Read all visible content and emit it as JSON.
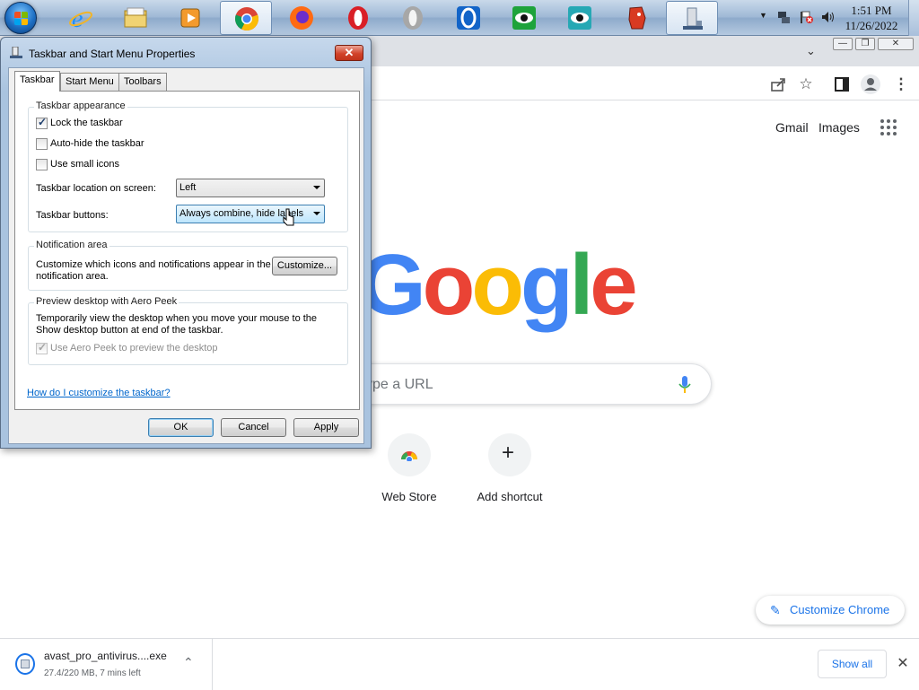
{
  "taskbar": {
    "apps": [
      {
        "name": "internet-explorer",
        "icon": "ie-icon",
        "color": "#1e90ff"
      },
      {
        "name": "windows-explorer",
        "icon": "folder-icon",
        "color": "#e9c65a"
      },
      {
        "name": "media-player",
        "icon": "media-player-icon",
        "color": "#f39a2d"
      },
      {
        "name": "chrome",
        "icon": "chrome-icon",
        "color": "#4285f4",
        "active": true
      },
      {
        "name": "firefox",
        "icon": "firefox-icon",
        "color": "#ff6a13"
      },
      {
        "name": "opera",
        "icon": "opera-icon",
        "color": "#d91f26"
      },
      {
        "name": "opera-gray",
        "icon": "opera-gray-icon",
        "color": "#a7a7a7"
      },
      {
        "name": "opera-blue",
        "icon": "opera-blue-icon",
        "color": "#1264c8"
      },
      {
        "name": "eye-app-green",
        "icon": "eye-green-icon",
        "color": "#1ea33b"
      },
      {
        "name": "eye-app-teal",
        "icon": "eye-teal-icon",
        "color": "#26a8b4"
      },
      {
        "name": "red-face-app",
        "icon": "red-face-icon",
        "color": "#d83a22"
      },
      {
        "name": "taskbar-properties",
        "icon": "taskbar-props-icon",
        "color": "#6a7f99",
        "active": true
      }
    ],
    "clock": {
      "time": "1:51 PM",
      "date": "11/26/2022"
    }
  },
  "chrome": {
    "links": {
      "gmail": "Gmail",
      "images": "Images"
    },
    "logo": [
      "G",
      "o",
      "o",
      "g",
      "l",
      "e"
    ],
    "logo_colors": [
      "#4285f4",
      "#ea4335",
      "#fbbc05",
      "#4285f4",
      "#34a853",
      "#ea4335"
    ],
    "search_placeholder": "ype a URL",
    "shortcuts": [
      {
        "label": "Web Store",
        "icon": "web-store-icon"
      },
      {
        "label": "Add shortcut",
        "icon": "plus-icon",
        "glyph": "+"
      }
    ],
    "customize_label": "Customize Chrome",
    "download": {
      "file_name": "avast_pro_antivirus....exe",
      "progress_text": "27.4/220 MB, 7 mins left",
      "show_all": "Show all"
    }
  },
  "dialog": {
    "title": "Taskbar and Start Menu Properties",
    "close_glyph": "✕",
    "tabs": [
      "Taskbar",
      "Start Menu",
      "Toolbars"
    ],
    "appearance": {
      "title": "Taskbar appearance",
      "lock": "Lock the taskbar",
      "autohide": "Auto-hide the taskbar",
      "small_icons": "Use small icons",
      "location_label": "Taskbar location on screen:",
      "location_value": "Left",
      "buttons_label": "Taskbar buttons:",
      "buttons_value": "Always combine, hide labels"
    },
    "checks": {
      "lock": true,
      "autohide": false,
      "small_icons": false,
      "aero_peek": true
    },
    "notification": {
      "title": "Notification area",
      "desc_line1": "Customize which icons and notifications appear in the",
      "desc_line2": "notification area.",
      "button": "Customize..."
    },
    "aero": {
      "title": "Preview desktop with Aero Peek",
      "desc_line1": "Temporarily view the desktop when you move your mouse to the",
      "desc_line2": "Show desktop button at end of the taskbar.",
      "checkbox": "Use Aero Peek to preview the desktop"
    },
    "help_link": "How do I customize the taskbar?",
    "buttons": {
      "ok": "OK",
      "cancel": "Cancel",
      "apply": "Apply"
    }
  }
}
